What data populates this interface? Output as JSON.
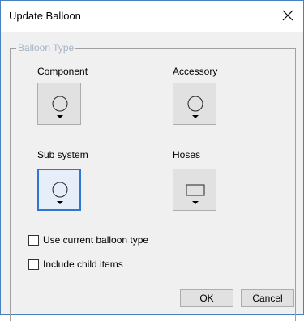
{
  "dialog": {
    "title": "Update Balloon",
    "close_symbol": "close-icon"
  },
  "balloon_type": {
    "legend": "Balloon Type",
    "options": [
      {
        "label": "Component",
        "shape": "circle",
        "selected": false
      },
      {
        "label": "Accessory",
        "shape": "circle",
        "selected": false
      },
      {
        "label": "Sub system",
        "shape": "circle",
        "selected": true
      },
      {
        "label": "Hoses",
        "shape": "rectangle",
        "selected": false
      }
    ]
  },
  "checkboxes": {
    "use_current": {
      "label": "Use current balloon type",
      "checked": false
    },
    "include_child": {
      "label": "Include child items",
      "checked": false
    }
  },
  "buttons": {
    "ok": "OK",
    "cancel": "Cancel"
  },
  "colors": {
    "accent": "#2f78d0",
    "legend_text": "#a6b4c6"
  }
}
